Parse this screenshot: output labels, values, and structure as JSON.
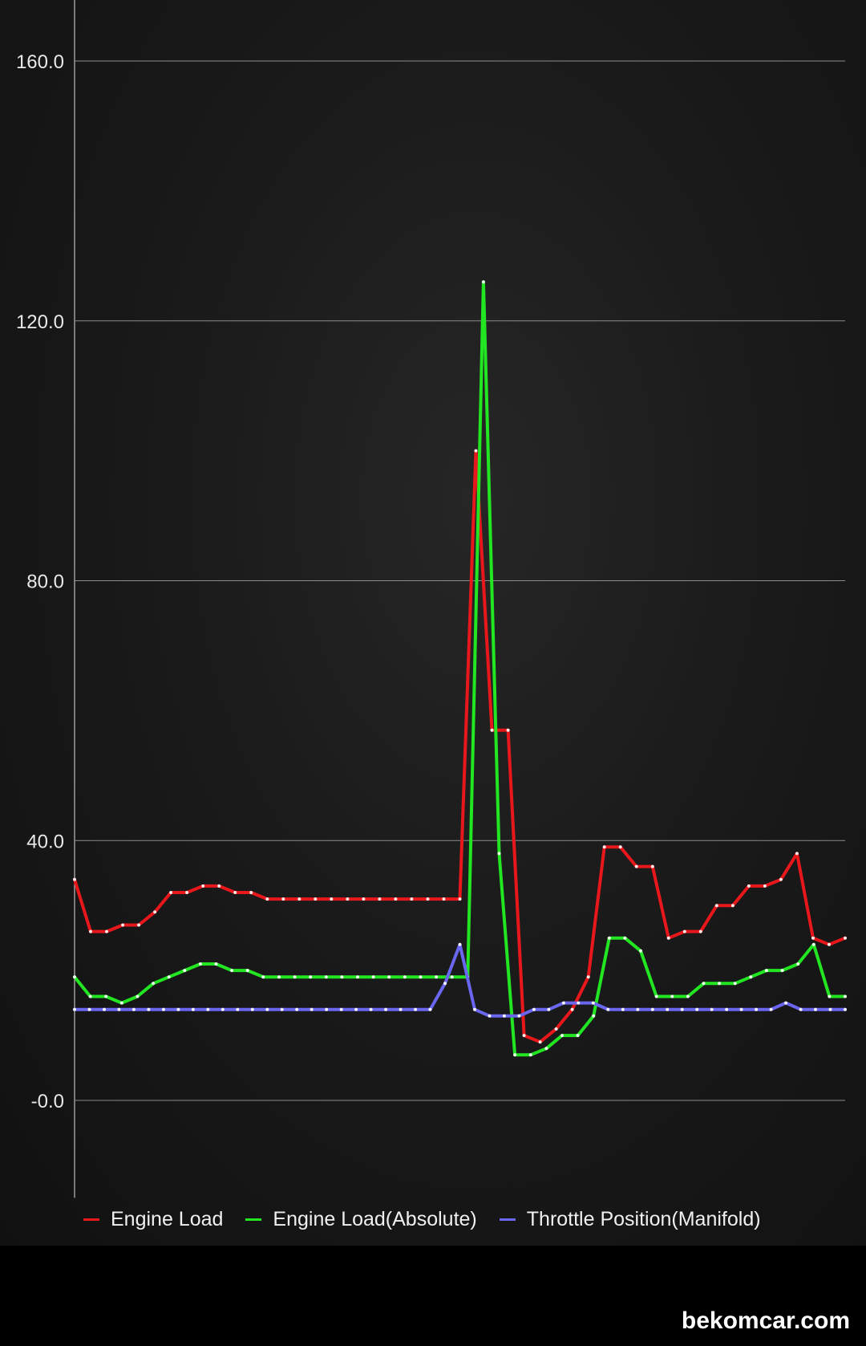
{
  "chart_data": {
    "type": "line",
    "x": [
      0,
      1,
      2,
      3,
      4,
      5,
      6,
      7,
      8,
      9,
      10,
      11,
      12,
      13,
      14,
      15,
      16,
      17,
      18,
      19,
      20,
      21,
      22,
      23,
      24,
      25,
      26,
      27,
      28,
      29,
      30,
      31,
      32,
      33,
      34,
      35,
      36,
      37,
      38,
      39,
      40,
      41,
      42,
      43,
      44,
      45,
      46,
      47,
      48,
      49,
      50,
      51,
      52,
      53,
      54,
      55,
      56,
      57,
      58,
      59,
      60
    ],
    "yticks": [
      160.0,
      120.0,
      80.0,
      40.0,
      0.0
    ],
    "ytick_labels": [
      "160.0",
      "120.0",
      "80.0",
      "40.0",
      "-0.0"
    ],
    "ylim": [
      -15,
      169
    ],
    "grid": true,
    "legend_position": "bottom-left",
    "series": [
      {
        "name": "Engine Load",
        "color": "#e8171b",
        "values": [
          34,
          26,
          26,
          27,
          27,
          29,
          32,
          32,
          33,
          33,
          32,
          32,
          31,
          31,
          31,
          31,
          31,
          31,
          31,
          31,
          31,
          31,
          31,
          31,
          31,
          100,
          57,
          57,
          10,
          9,
          11,
          14,
          19,
          39,
          39,
          36,
          36,
          25,
          26,
          26,
          30,
          30,
          33,
          33,
          34,
          38,
          25,
          24,
          25
        ]
      },
      {
        "name": "Engine Load(Absolute)",
        "color": "#22e622",
        "values": [
          19,
          16,
          16,
          15,
          16,
          18,
          19,
          20,
          21,
          21,
          20,
          20,
          19,
          19,
          19,
          19,
          19,
          19,
          19,
          19,
          19,
          19,
          19,
          19,
          19,
          19,
          126,
          38,
          7,
          7,
          8,
          10,
          10,
          13,
          25,
          25,
          23,
          16,
          16,
          16,
          18,
          18,
          18,
          19,
          20,
          20,
          21,
          24,
          16,
          16
        ]
      },
      {
        "name": "Throttle Position(Manifold)",
        "color": "#6a66f0",
        "values": [
          14,
          14,
          14,
          14,
          14,
          14,
          14,
          14,
          14,
          14,
          14,
          14,
          14,
          14,
          14,
          14,
          14,
          14,
          14,
          14,
          14,
          14,
          14,
          14,
          14,
          18,
          24,
          14,
          13,
          13,
          13,
          14,
          14,
          15,
          15,
          15,
          14,
          14,
          14,
          14,
          14,
          14,
          14,
          14,
          14,
          14,
          14,
          14,
          15,
          14,
          14,
          14,
          14
        ]
      }
    ]
  },
  "watermark": "bekomcar.com"
}
